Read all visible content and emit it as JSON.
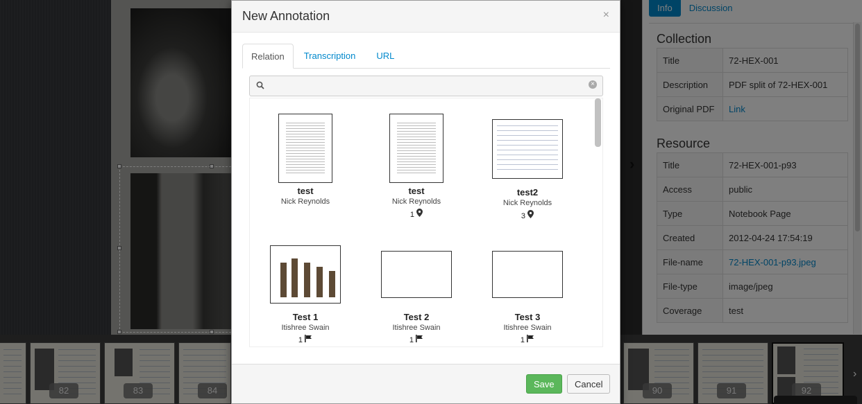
{
  "info_panel": {
    "tabs": [
      {
        "label": "Info"
      },
      {
        "label": "Discussion"
      }
    ],
    "collection": {
      "heading": "Collection",
      "rows": [
        {
          "key": "Title",
          "value": "72-HEX-001"
        },
        {
          "key": "Description",
          "value": "PDF split of 72-HEX-001"
        },
        {
          "key": "Original PDF",
          "value": "Link"
        }
      ]
    },
    "resource": {
      "heading": "Resource",
      "rows": [
        {
          "key": "Title",
          "value": "72-HEX-001-p93"
        },
        {
          "key": "Access",
          "value": "public"
        },
        {
          "key": "Type",
          "value": "Notebook Page"
        },
        {
          "key": "Created",
          "value": "2012-04-24 17:54:19"
        },
        {
          "key": "File-name",
          "value": "72-HEX-001-p93.jpeg"
        },
        {
          "key": "File-type",
          "value": "image/jpeg"
        },
        {
          "key": "Coverage",
          "value": "test"
        }
      ]
    }
  },
  "filmstrip": {
    "pages": [
      "82",
      "83",
      "84",
      "90",
      "91",
      "92"
    ],
    "selected_page": "92"
  },
  "modal": {
    "title": "New Annotation",
    "close": "×",
    "tabs": [
      {
        "label": "Relation"
      },
      {
        "label": "Transcription"
      },
      {
        "label": "URL"
      }
    ],
    "active_tab": "Relation",
    "search": {
      "placeholder": "",
      "value": ""
    },
    "results": [
      {
        "title": "test",
        "author": "Nick Reynolds",
        "meta": "",
        "meta_icon": ""
      },
      {
        "title": "test",
        "author": "Nick Reynolds",
        "meta": "1",
        "meta_icon": "map-marker-icon"
      },
      {
        "title": "test2",
        "author": "Nick Reynolds",
        "meta": "3",
        "meta_icon": "map-marker-icon"
      },
      {
        "title": "Test 1",
        "author": "Itishree Swain",
        "meta": "1",
        "meta_icon": "flag-icon"
      },
      {
        "title": "Test 2",
        "author": "Itishree Swain",
        "meta": "1",
        "meta_icon": "flag-icon"
      },
      {
        "title": "Test 3",
        "author": "Itishree Swain",
        "meta": "1",
        "meta_icon": "flag-icon"
      }
    ],
    "buttons": {
      "save": "Save",
      "cancel": "Cancel"
    }
  },
  "colors": {
    "accent": "#0088cc",
    "save": "#5bb75b"
  }
}
